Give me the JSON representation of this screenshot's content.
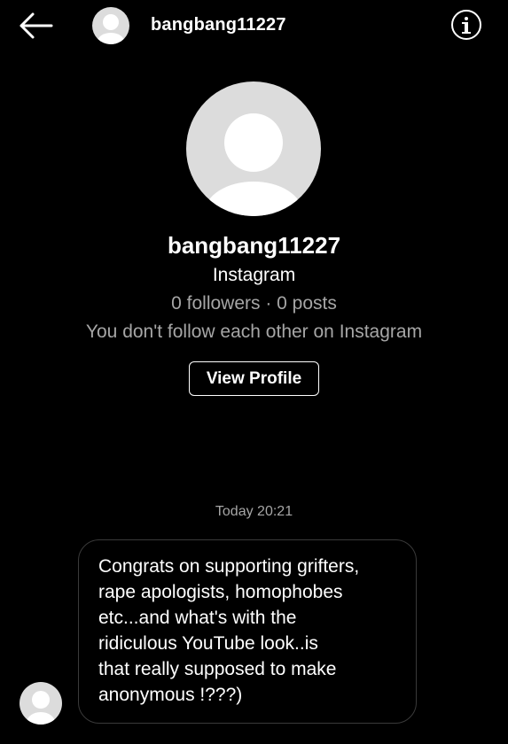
{
  "header": {
    "back_icon": "arrow-left-icon",
    "username": "bangbang11227",
    "info_icon": "info-circle-icon"
  },
  "profile": {
    "name": "bangbang11227",
    "source": "Instagram",
    "stats": "0 followers · 0 posts",
    "relation": "You don't follow each other on Instagram",
    "view_profile_label": "View Profile"
  },
  "conversation": {
    "timestamp": "Today 20:21",
    "messages": [
      {
        "text": "Congrats on supporting grifters,\nrape apologists, homophobes\netc...and what's with the\nridiculous YouTube look..is\nthat really supposed to make\nanonymous !???)"
      }
    ]
  },
  "colors": {
    "background": "#000000",
    "text": "#ffffff",
    "muted_text": "#a6a6a6",
    "bubble_border": "#3a3a3a",
    "avatar_placeholder": "#dcdcdc"
  }
}
